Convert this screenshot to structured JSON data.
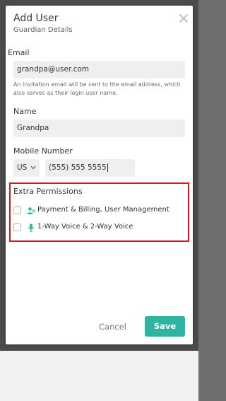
{
  "dialog": {
    "title": "Add User",
    "subtitle": "Guardian Details"
  },
  "form": {
    "email": {
      "label": "Email",
      "value": "grandpa@user.com",
      "hint": "An invitation email will be sent to the email address, which also serves as their login user name."
    },
    "name": {
      "label": "Name",
      "value": "Grandpa"
    },
    "mobile": {
      "label": "Mobile Number",
      "country": "US",
      "value": "(555) 555 5555"
    }
  },
  "permissions": {
    "title": "Extra Permissions",
    "items": [
      {
        "label": "Payment & Billing, User Management",
        "icon": "user-settings-icon",
        "checked": false
      },
      {
        "label": "1-Way Voice & 2-Way Voice",
        "icon": "microphone-icon",
        "checked": false
      }
    ]
  },
  "actions": {
    "cancel": "Cancel",
    "save": "Save"
  },
  "colors": {
    "accent": "#2db4a0",
    "highlight": "#e3141b"
  }
}
